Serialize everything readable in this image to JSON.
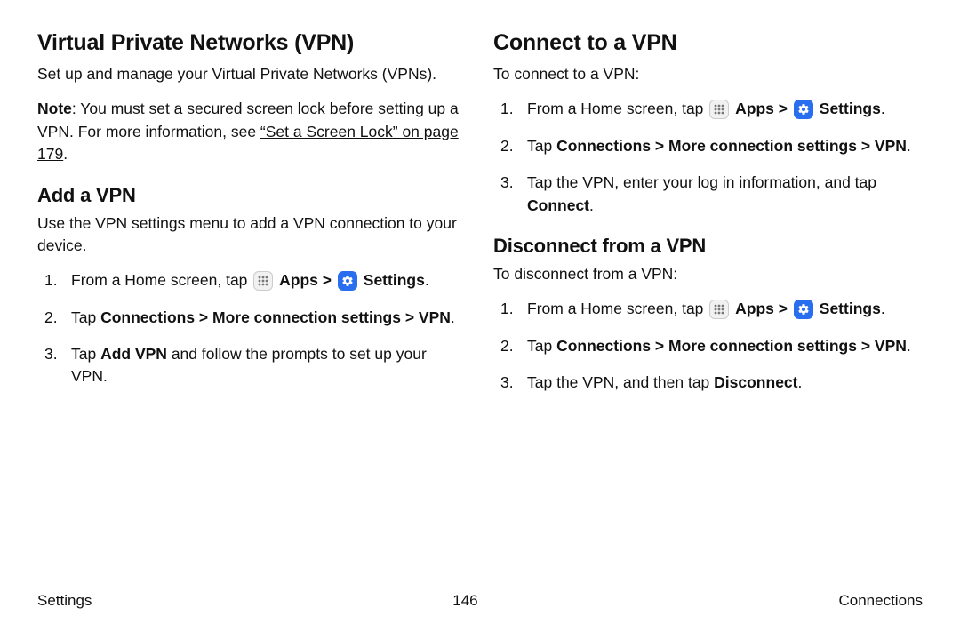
{
  "left": {
    "h1": "Virtual Private Networks (VPN)",
    "intro": "Set up and manage your Virtual Private Networks (VPNs).",
    "note_label": "Note",
    "note_text": ": You must set a secured screen lock before setting up a VPN. For more information, see ",
    "note_link": "“Set a Screen Lock” on page 179",
    "note_end": ".",
    "h2": "Add a VPN",
    "add_intro": "Use the VPN settings menu to add a VPN connection to your device.",
    "steps": {
      "s1_pre": "From a Home screen, tap",
      "s1_apps": "Apps",
      "s1_gt": ">",
      "s1_settings": "Settings",
      "s1_end": ".",
      "s2_pre": "Tap ",
      "s2_bold": "Connections > More connection settings > VPN",
      "s2_end": ".",
      "s3_pre": "Tap ",
      "s3_bold": "Add VPN",
      "s3_post": " and follow the prompts to set up your VPN."
    }
  },
  "right": {
    "h1": "Connect to a VPN",
    "connect_intro": "To connect to a VPN:",
    "c1_pre": "From a Home screen, tap",
    "c1_apps": "Apps",
    "c1_gt": ">",
    "c1_settings": "Settings",
    "c1_end": ".",
    "c2_pre": "Tap ",
    "c2_bold": "Connections > More connection settings > VPN",
    "c2_end": ".",
    "c3_pre": "Tap the VPN, enter your log in information, and tap ",
    "c3_bold": "Connect",
    "c3_end": ".",
    "h2": "Disconnect from a VPN",
    "disc_intro": "To disconnect from a VPN:",
    "d1_pre": "From a Home screen, tap",
    "d1_apps": "Apps",
    "d1_gt": ">",
    "d1_settings": "Settings",
    "d1_end": ".",
    "d2_pre": "Tap ",
    "d2_bold": "Connections > More connection settings > VPN",
    "d2_end": ".",
    "d3_pre": "Tap the VPN, and then tap ",
    "d3_bold": "Disconnect",
    "d3_end": "."
  },
  "footer": {
    "left": "Settings",
    "center": "146",
    "right": "Connections"
  }
}
